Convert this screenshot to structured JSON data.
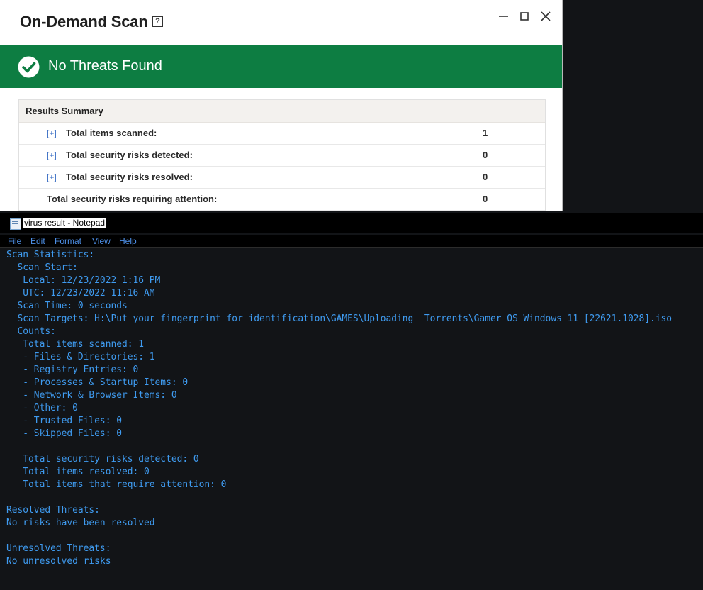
{
  "scan_window": {
    "title": "On-Demand Scan",
    "help_glyph": "?",
    "status": "No Threats Found",
    "colors": {
      "banner": "#0d7d42",
      "link": "#2d64c0"
    },
    "results_header": "Results Summary",
    "expand_label": "[+]",
    "rows": [
      {
        "label": "Total items scanned:",
        "value": "1"
      },
      {
        "label": "Total security risks detected:",
        "value": "0"
      },
      {
        "label": "Total security risks resolved:",
        "value": "0"
      },
      {
        "label": "Total security risks requiring attention:",
        "value": "0"
      }
    ]
  },
  "notepad": {
    "title": "virus result - Notepad",
    "menu": [
      "File",
      "Edit",
      "Format",
      "View",
      "Help"
    ],
    "text_color": "#3f9bf0",
    "lines": [
      "Scan Statistics:",
      "  Scan Start:",
      "   Local: 12/23/2022 1:16 PM",
      "   UTC: 12/23/2022 11:16 AM",
      "  Scan Time: 0 seconds",
      "  Scan Targets: H:\\Put your fingerprint for identification\\GAMES\\Uploading  Torrents\\Gamer OS Windows 11 [22621.1028].iso",
      "  Counts:",
      "   Total items scanned: 1",
      "   - Files & Directories: 1",
      "   - Registry Entries: 0",
      "   - Processes & Startup Items: 0",
      "   - Network & Browser Items: 0",
      "   - Other: 0",
      "   - Trusted Files: 0",
      "   - Skipped Files: 0",
      "",
      "   Total security risks detected: 0",
      "   Total items resolved: 0",
      "   Total items that require attention: 0",
      "",
      "Resolved Threats:",
      "No risks have been resolved",
      "",
      "Unresolved Threats:",
      "No unresolved risks"
    ]
  }
}
